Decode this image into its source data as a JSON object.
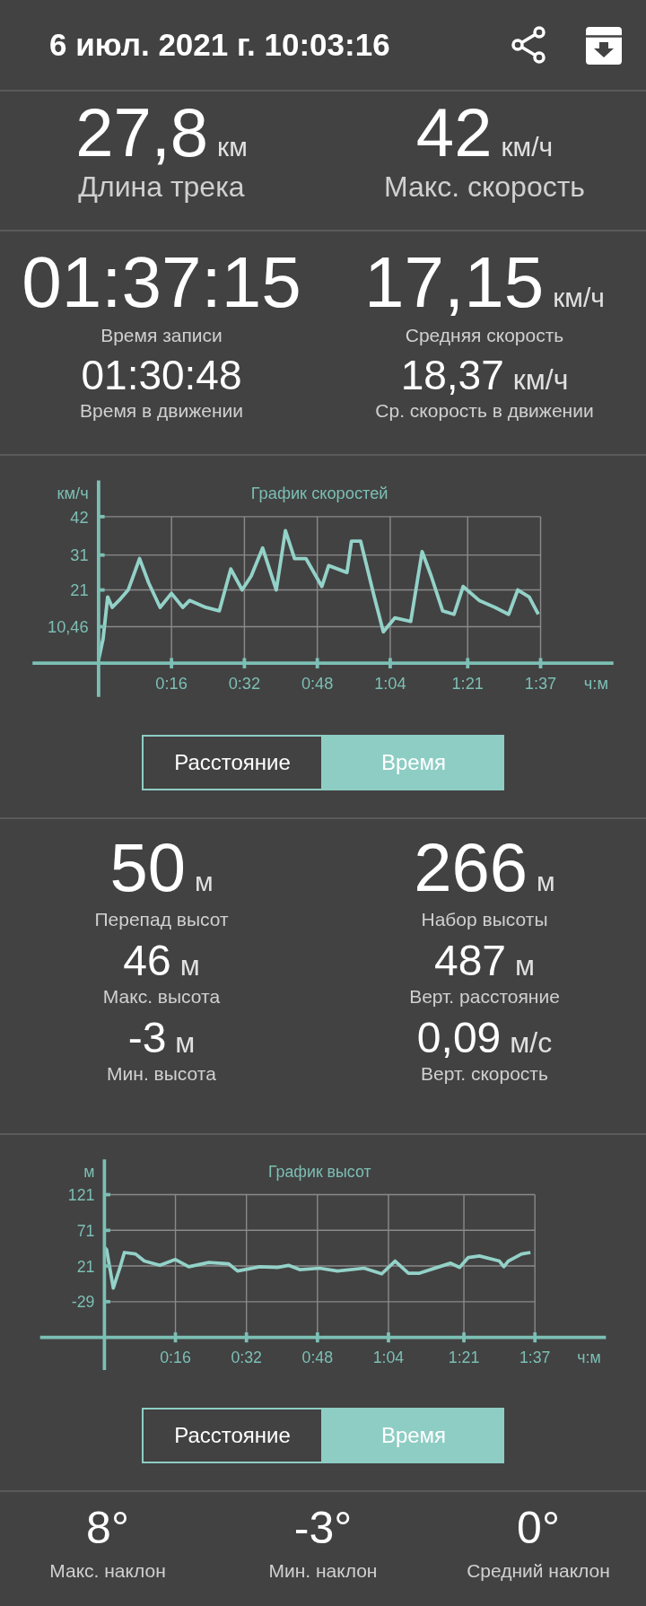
{
  "header": {
    "title": "6 июл. 2021 г. 10:03:16"
  },
  "distance_stats": {
    "columns": [
      [
        {
          "kind": "large",
          "value": "27,8",
          "unit": "км",
          "label": "Длина трека"
        }
      ],
      [
        {
          "kind": "large",
          "value": "42",
          "unit": "км/ч",
          "label": "Макс. скорость"
        }
      ]
    ]
  },
  "time_stats": {
    "columns": [
      [
        {
          "kind": "huge",
          "value": "01:37:15",
          "label": "Время записи"
        },
        {
          "kind": "small",
          "value": "01:30:48",
          "label": "Время в движении"
        }
      ],
      [
        {
          "kind": "huge",
          "value": "17,15",
          "unit": "км/ч",
          "label": "Средняя скорость"
        },
        {
          "kind": "small",
          "value": "18,37",
          "unit": "км/ч",
          "label": "Ср. скорость в движении"
        }
      ]
    ]
  },
  "speed_chart": {
    "chart_data": {
      "type": "line",
      "title": "График скоростей",
      "xlabel": "ч:м",
      "ylabel": "км/ч",
      "xlim": [
        -14.5,
        113
      ],
      "ylim": [
        0,
        42
      ],
      "grid": true,
      "xticks": [
        {
          "value": 16,
          "label": "0:16"
        },
        {
          "value": 32,
          "label": "0:32"
        },
        {
          "value": 48,
          "label": "0:48"
        },
        {
          "value": 64,
          "label": "1:04"
        },
        {
          "value": 81,
          "label": "1:21"
        },
        {
          "value": 97,
          "label": "1:37"
        }
      ],
      "yticks": [
        {
          "value": 10.46,
          "label": "10,46"
        },
        21,
        31,
        42
      ],
      "x": [
        0,
        1,
        2,
        3,
        4.5,
        6.5,
        9,
        11,
        13.5,
        16,
        18.5,
        20,
        23.5,
        26.5,
        29,
        31.5,
        33.5,
        36,
        39,
        41,
        43,
        45.5,
        49,
        50.5,
        54.5,
        55.5,
        57.5,
        60.5,
        62.5,
        65,
        68.5,
        71,
        73,
        75.5,
        78,
        80,
        83.5,
        87,
        90,
        92,
        94.5,
        96.5
      ],
      "series": [
        {
          "color": "#93d2c8",
          "values": [
            1,
            7,
            19,
            16,
            18,
            21,
            30,
            23,
            16,
            20,
            16,
            18,
            16,
            15,
            27,
            21,
            25,
            33,
            21,
            38,
            30,
            30,
            22,
            28,
            26,
            35,
            35,
            19,
            9,
            13,
            12,
            32,
            25,
            15,
            14,
            22,
            18,
            16,
            14,
            21,
            19,
            14
          ]
        }
      ]
    },
    "toggle": [
      {
        "label": "Расстояние",
        "selected": false
      },
      {
        "label": "Время",
        "selected": true
      }
    ]
  },
  "altitude_stats": {
    "columns": [
      [
        {
          "kind": "big",
          "value": "50",
          "unit": "м",
          "label": "Перепад высот"
        },
        {
          "kind": "medium",
          "value": "46",
          "unit": "м",
          "label": "Макс. высота"
        },
        {
          "kind": "medium",
          "value": "-3",
          "unit": "м",
          "label": "Мин. высота"
        }
      ],
      [
        {
          "kind": "big",
          "value": "266",
          "unit": "м",
          "label": "Набор высоты"
        },
        {
          "kind": "medium",
          "value": "487",
          "unit": "м",
          "label": "Верт. расстояние"
        },
        {
          "kind": "medium",
          "value": "0,09",
          "unit": "м/с",
          "label": "Верт. скорость"
        }
      ]
    ]
  },
  "altitude_chart": {
    "chart_data": {
      "type": "line",
      "title": "График высот",
      "xlabel": "ч:м",
      "ylabel": "м",
      "xlim": [
        -14.5,
        113
      ],
      "ylim": [
        -79,
        121
      ],
      "grid": true,
      "xticks": [
        {
          "value": 16,
          "label": "0:16"
        },
        {
          "value": 32,
          "label": "0:32"
        },
        {
          "value": 48,
          "label": "0:48"
        },
        {
          "value": 64,
          "label": "1:04"
        },
        {
          "value": 81,
          "label": "1:21"
        },
        {
          "value": 97,
          "label": "1:37"
        }
      ],
      "yticks": [
        -29,
        21,
        71,
        121
      ],
      "x": [
        0,
        0.5,
        2,
        3.5,
        4.5,
        7,
        9,
        12.5,
        16,
        19,
        23.5,
        28,
        30,
        35,
        39,
        41.5,
        44,
        48.5,
        52.5,
        58.5,
        62.5,
        65.5,
        68.5,
        71,
        75,
        78,
        80,
        82,
        84.5,
        89,
        90,
        91,
        94,
        96
      ],
      "series": [
        {
          "color": "#93d2c8",
          "values": [
            47,
            44,
            -10,
            19,
            40,
            38,
            28,
            22,
            30,
            20,
            26,
            24,
            14,
            20,
            19,
            22,
            16,
            18,
            14,
            18,
            10,
            28,
            11,
            11,
            19,
            25,
            19,
            33,
            35,
            28,
            20,
            28,
            38,
            40
          ]
        }
      ]
    },
    "toggle": [
      {
        "label": "Расстояние",
        "selected": false
      },
      {
        "label": "Время",
        "selected": true
      }
    ]
  },
  "slope_stats": [
    {
      "value": "8°",
      "label": "Макс. наклон"
    },
    {
      "value": "-3°",
      "label": "Мин. наклон"
    },
    {
      "value": "0°",
      "label": "Средний наклон"
    }
  ]
}
